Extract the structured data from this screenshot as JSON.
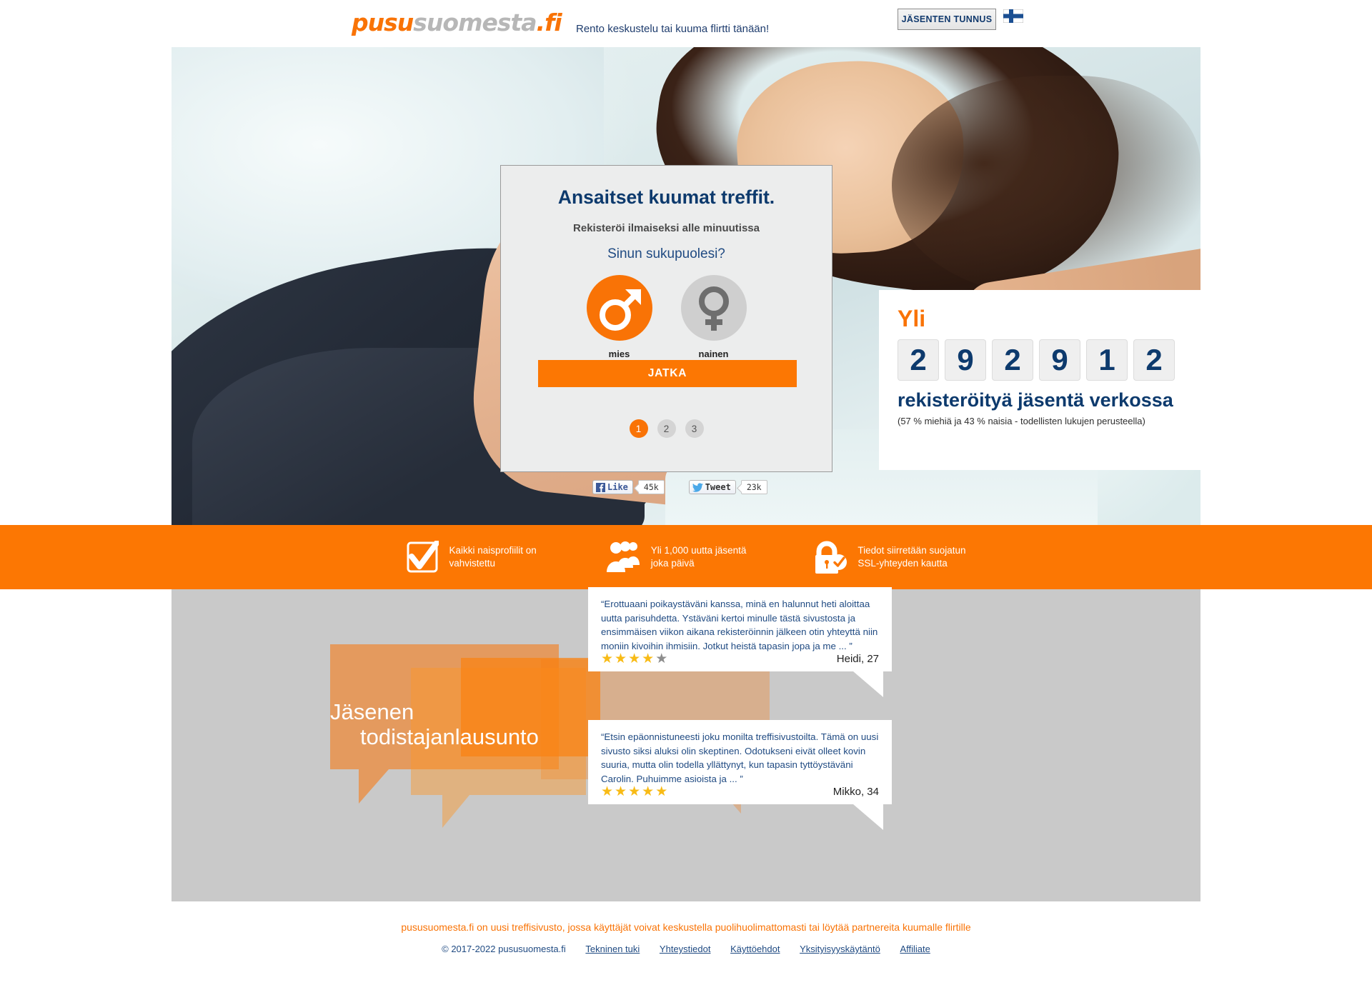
{
  "header": {
    "logo_orange_1": "pusu",
    "logo_gray": "suomesta",
    "logo_orange_2": ".fi",
    "tagline": "Rento keskustelu tai kuuma flirtti tänään!",
    "login_label": "JÄSENTEN TUNNUS",
    "flag_icon": "finland-flag-icon"
  },
  "registration": {
    "title": "Ansaitset kuumat treffit.",
    "subtitle": "Rekisteröi ilmaiseksi alle minuutissa",
    "question": "Sinun sukupuolesi?",
    "male_label": "mies",
    "female_label": "nainen",
    "male_icon": "mars-symbol-icon",
    "female_icon": "venus-symbol-icon",
    "cta_label": "JATKA",
    "steps": [
      "1",
      "2",
      "3"
    ],
    "active_step": "1",
    "accent_color": "#f97306",
    "title_color": "#0d3a6d"
  },
  "social": {
    "facebook_label": "Like",
    "facebook_count": "45k",
    "facebook_icon": "facebook-icon",
    "twitter_label": "Tweet",
    "twitter_count": "23k",
    "twitter_icon": "twitter-bird-icon"
  },
  "counter": {
    "prefix": "Yli",
    "digits": [
      "2",
      "9",
      "2",
      "9",
      "1",
      "2"
    ],
    "heading": "rekisteröityä jäsentä verkossa",
    "note": "(57 % miehiä ja 43 % naisia - todellisten lukujen perusteella)"
  },
  "features": {
    "bar_color": "#fc7703",
    "items": [
      {
        "icon": "checkbox-check-icon",
        "text": "Kaikki naisprofiilit on\nvahvistettu"
      },
      {
        "icon": "people-group-icon",
        "text": "Yli 1,000 uutta jäsentä\njoka päivä"
      },
      {
        "icon": "lock-shield-icon",
        "text": "Tiedot siirretään suojatun\nSSL-yhteyden kautta"
      }
    ]
  },
  "testimonials": {
    "heading_line1": "Jäsenen",
    "heading_line2": "todistajanlausunto",
    "quotes": [
      {
        "text": "“Erottuaani poikaystäväni kanssa, minä en halunnut heti aloittaa uutta parisuhdetta. Ystäväni kertoi minulle tästä sivustosta ja ensimmäisen viikon aikana rekisteröinnin jälkeen otin yhteyttä niin moniin kivoihin ihmisiin. Jotkut heistä tapasin jopa ja me ... ”",
        "rating": 4,
        "max_rating": 5,
        "author": "Heidi, 27"
      },
      {
        "text": "“Etsin epäonnistuneesti joku monilta treffisivustoilta. Tämä on uusi sivusto siksi aluksi olin skeptinen. Odotukseni eivät olleet kovin suuria, mutta olin todella yllättynyt, kun tapasin tyttöystäväni Carolin. Puhuimme asioista ja ... ”",
        "rating": 5,
        "max_rating": 5,
        "author": "Mikko, 34"
      }
    ]
  },
  "footer": {
    "description": "pususuomesta.fi on uusi treffisivusto, jossa käyttäjät voivat keskustella puolihuolimattomasti tai löytää partnereita kuumalle flirtille",
    "copyright": "© 2017-2022 pususuomesta.fi",
    "links": [
      "Tekninen tuki",
      "Yhteystiedot",
      "Käyttöehdot",
      "Yksityisyyskäytäntö",
      "Affiliate"
    ]
  }
}
